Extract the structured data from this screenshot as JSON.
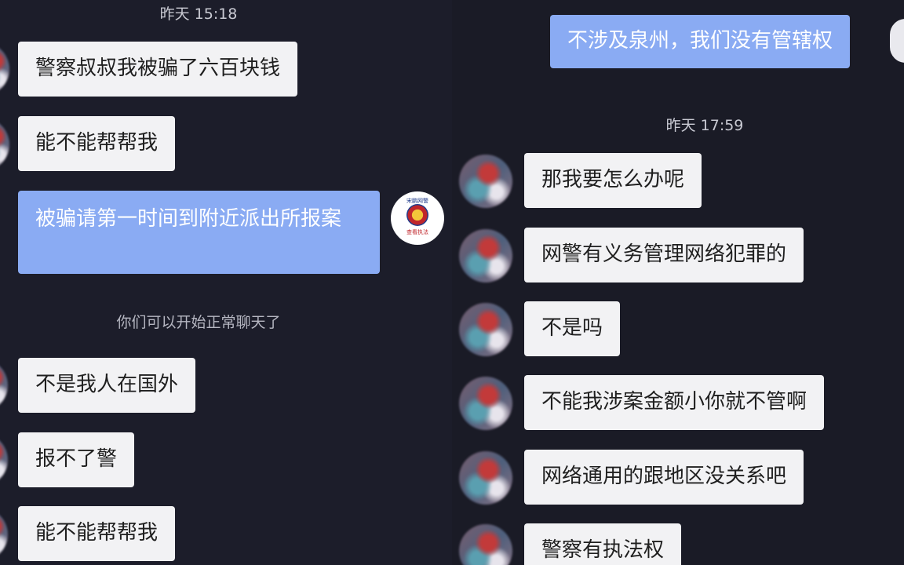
{
  "left": {
    "timestamp": "昨天 15:18",
    "messages": [
      {
        "text": "警察叔叔我被骗了六百块钱"
      },
      {
        "text": "能不能帮帮我"
      },
      {
        "text": "被骗请第一时间到附近派出所报案"
      },
      {
        "text": "不是我人在国外"
      },
      {
        "text": "报不了警"
      },
      {
        "text": "能不能帮帮我"
      }
    ],
    "notice": "你们可以开始正常聊天了",
    "police_avatar": {
      "top_text": "宋鹏网警",
      "bottom_text": "查看执法"
    }
  },
  "right": {
    "timestamp": "昨天 17:59",
    "messages": [
      {
        "text": "不涉及泉州，我们没有管辖权"
      },
      {
        "text": "那我要怎么办呢"
      },
      {
        "text": "网警有义务管理网络犯罪的"
      },
      {
        "text": "不是吗"
      },
      {
        "text": "不能我涉案金额小你就不管啊"
      },
      {
        "text": "网络通用的跟地区没关系吧"
      },
      {
        "text": "警察有执法权"
      }
    ]
  },
  "colors": {
    "background": "#1c1d2a",
    "incoming_bubble": "#f2f2f4",
    "outgoing_bubble": "#8aabf3"
  }
}
